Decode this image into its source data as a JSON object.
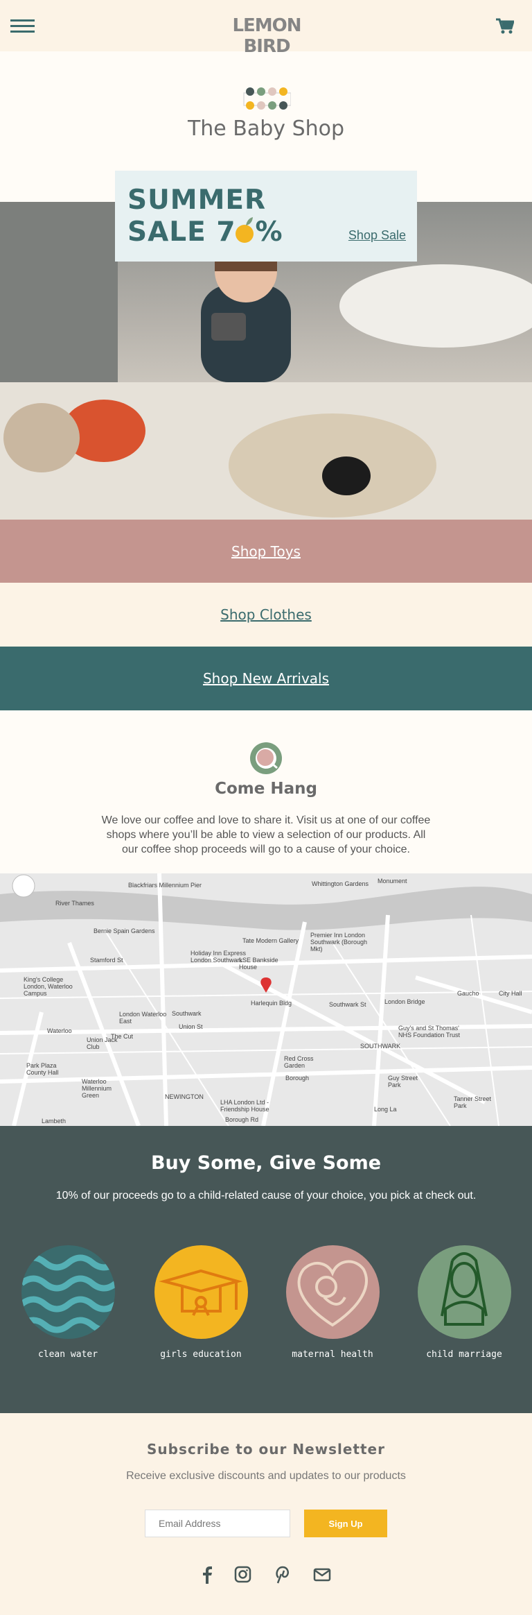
{
  "header": {
    "logo": "LEMON BIRD",
    "menu_icon": "hamburger-icon",
    "cart_icon": "cart-icon"
  },
  "shop_title": "The Baby Shop",
  "sale": {
    "line1": "SUMMER",
    "line2_prefix": "SALE 7",
    "line2_suffix": "%",
    "link": "Shop Sale"
  },
  "bands": [
    {
      "label": "Shop Toys",
      "bg": "#c4958f",
      "color": "#ffffff"
    },
    {
      "label": "Shop Clothes",
      "bg": "#fcf3e6",
      "color": "#3a6b6d"
    },
    {
      "label": "Shop New Arrivals",
      "bg": "#3a6b6d",
      "color": "#ffffff"
    }
  ],
  "hang": {
    "title": "Come Hang",
    "text": "We love our coffee and love to share it. Visit us at one of our coffee shops where you’ll be able to view a selection of our products. All our coffee shop proceeds will go to a cause of your choice."
  },
  "map": {
    "labels": [
      "River Thames",
      "Blackfriars Millennium Pier",
      "Whittington Gardens",
      "Monument",
      "Bernie Spain Gardens",
      "Tate Modern Gallery",
      "Premier Inn London Southwark (Borough Mkt)",
      "Holiday Inn Express London Southwark",
      "LSE Bankside House",
      "King's College London, Waterloo Campus",
      "Stamford St",
      "Southwark",
      "Harlequin Bldg",
      "London Bridge",
      "Gaucho",
      "City Hall",
      "London Waterloo East",
      "Waterloo",
      "Union St",
      "Southwark St",
      "Guy's and St Thomas' NHS Foundation Trust",
      "Union Jack Club",
      "The Cut",
      "Red Cross Garden",
      "SOUTHWARK",
      "Park Plaza County Hall",
      "Waterloo Millennium Green",
      "NEWINGTON",
      "LHA London Ltd - Friendship House",
      "Borough",
      "Guy Street Park",
      "Tanner Street Park",
      "Lambeth",
      "Borough Rd",
      "Long La"
    ]
  },
  "buy": {
    "title": "Buy Some, Give Some",
    "text": "10% of our proceeds go to a child-related cause of your choice, you pick at check out.",
    "causes": [
      {
        "label": "clean water",
        "bg": "#3a6b6d",
        "icon": "waves-icon"
      },
      {
        "label": "girls education",
        "bg": "#f3b521",
        "icon": "graduation-cap-icon"
      },
      {
        "label": "maternal health",
        "bg": "#c4958f",
        "icon": "baby-heart-icon"
      },
      {
        "label": "child marriage",
        "bg": "#7a9e7e",
        "icon": "bride-icon"
      }
    ]
  },
  "newsletter": {
    "title": "Subscribe to our Newsletter",
    "subtitle": "Receive exclusive discounts and updates to our products",
    "placeholder": "Email Address",
    "button": "Sign Up"
  },
  "social": [
    "facebook-icon",
    "instagram-icon",
    "pinterest-icon",
    "email-icon"
  ],
  "colors": {
    "teal": "#3a6b6d",
    "cream": "#fcf3e6",
    "lemon": "#f3b521",
    "rose": "#c4958f",
    "slate": "#475757",
    "sage": "#7a9e7e"
  }
}
